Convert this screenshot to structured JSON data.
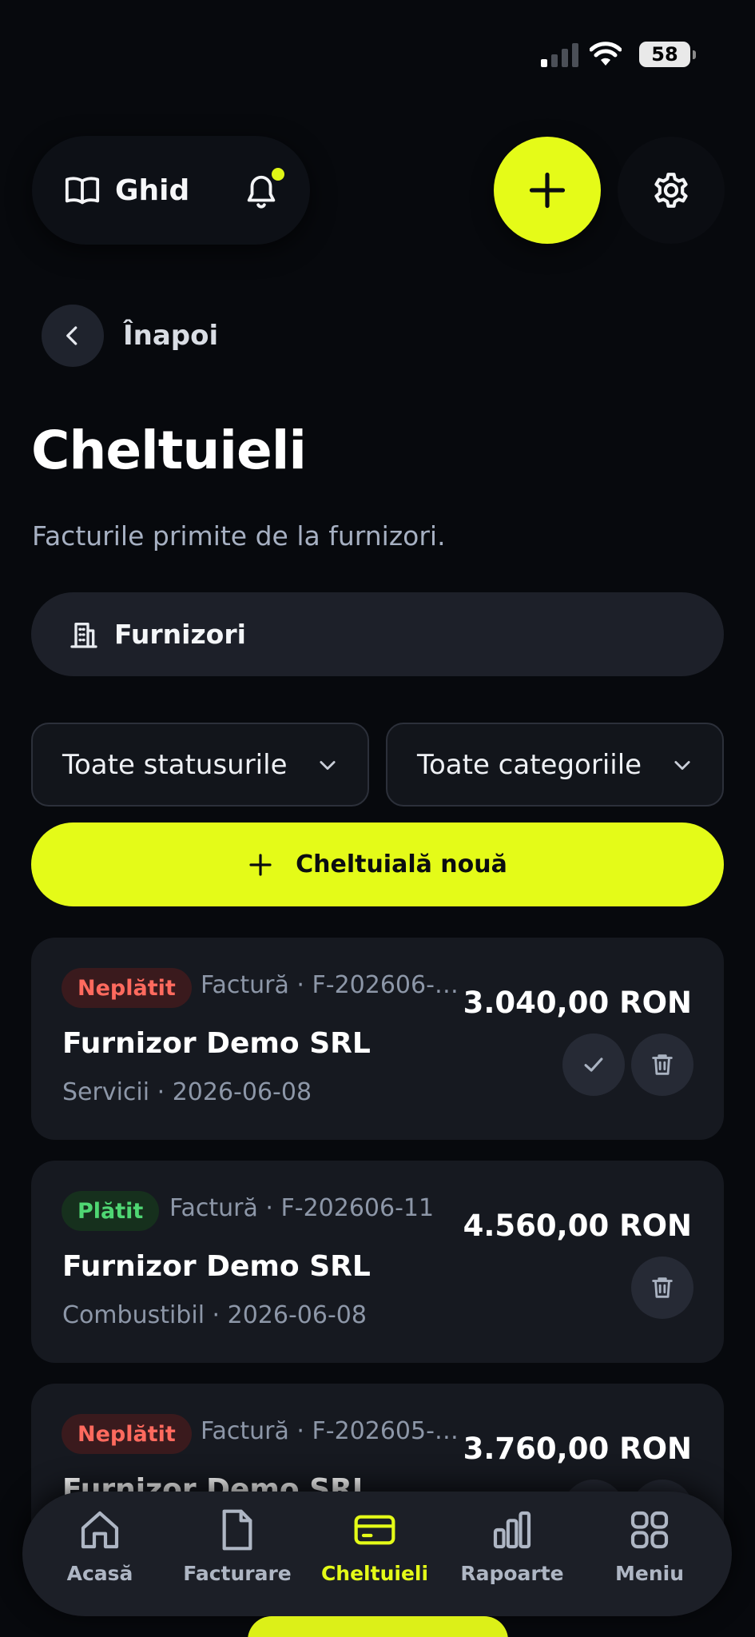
{
  "status_bar": {
    "battery": "58"
  },
  "header": {
    "guide_label": "Ghid",
    "icons": {
      "guide": "book-open-icon",
      "notifications": "bell-icon",
      "add": "plus-icon",
      "settings": "gear-icon"
    },
    "has_notification": true
  },
  "back": {
    "label": "Înapoi"
  },
  "page": {
    "title": "Cheltuieli",
    "subtitle": "Facturile primite de la furnizori."
  },
  "suppliers_button": {
    "label": "Furnizori",
    "icon": "building-icon"
  },
  "filters": {
    "status": {
      "selected": "Toate statusurile"
    },
    "category": {
      "selected": "Toate categoriile"
    }
  },
  "new_expense_button": {
    "label": "Cheltuială nouă"
  },
  "expenses": [
    {
      "status": "Neplătit",
      "ref": "Factură · F-202606-…",
      "supplier": "Furnizor Demo SRL",
      "meta": "Servicii · 2026-06-08",
      "amount": "3.040,00 RON"
    },
    {
      "status": "Plătit",
      "ref": "Factură · F-202606-11",
      "supplier": "Furnizor Demo SRL",
      "meta": "Combustibil · 2026-06-08",
      "amount": "4.560,00 RON"
    },
    {
      "status": "Neplătit",
      "ref": "Factură · F-202605-…",
      "supplier": "Furnizor Demo SRL",
      "meta": "",
      "amount": "3.760,00 RON"
    }
  ],
  "nav": {
    "items": [
      {
        "label": "Acasă",
        "icon": "home-icon"
      },
      {
        "label": "Facturare",
        "icon": "document-icon"
      },
      {
        "label": "Cheltuieli",
        "icon": "credit-card-icon"
      },
      {
        "label": "Rapoarte",
        "icon": "bar-chart-icon"
      },
      {
        "label": "Meniu",
        "icon": "grid-icon"
      }
    ],
    "active": "Cheltuieli"
  },
  "colors": {
    "accent": "#e4fb18",
    "background": "#07090d",
    "card": "#161920",
    "unpaid": "#ff6a5e",
    "paid": "#4fd673"
  }
}
